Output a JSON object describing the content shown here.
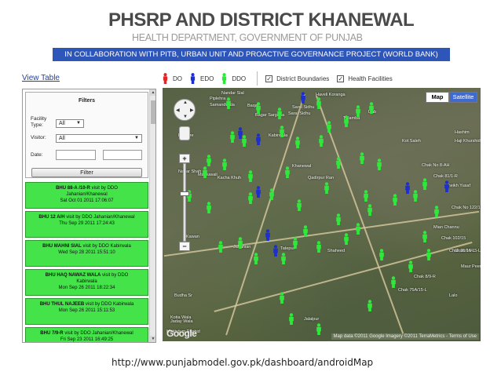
{
  "header": {
    "title": "PHSRP AND DISTRICT KHANEWAL",
    "subtitle": "HEALTH DEPARTMENT, GOVERNMENT OF PUNJAB",
    "banner": "IN COLLABORATION WITH PITB, URBAN UNIT AND PROACTIVE GOVERNANCE PROJECT (WORLD BANK)"
  },
  "links": {
    "view_table": "View Table"
  },
  "legend": {
    "items": [
      {
        "label": "DO",
        "color": "#e52424"
      },
      {
        "label": "EDO",
        "color": "#1d2fd0"
      },
      {
        "label": "DDO",
        "color": "#2ee83a"
      }
    ],
    "checkboxes": [
      {
        "label": "District Boundaries",
        "checked": true
      },
      {
        "label": "Health Facilities",
        "checked": true
      }
    ]
  },
  "filters": {
    "title": "Filters",
    "facility_type_label": "Facility Type:",
    "facility_type_value": "All",
    "visitor_label": "Visitor:",
    "visitor_value": "All",
    "date_label": "Date:",
    "filter_button": "Filter"
  },
  "visits": [
    {
      "facility": "BHU 88-A /10-R",
      "by": "visit by DDO",
      "visitor": "Jahanian/Khanewal",
      "datetime": "Sat Oct 01 2011 17:06:07"
    },
    {
      "facility": "BHU 12 A/H",
      "by": "visit by DDO",
      "visitor": "Jahanian/Khanewal",
      "datetime": "Thu Sep 29 2011 17:24:43"
    },
    {
      "facility": "BHU MAHNI SIAL",
      "by": "visit by DDO",
      "visitor": "Kabirwala",
      "datetime": "Wed Sep 28 2011 15:51:10"
    },
    {
      "facility": "BHU HAQ NAWAZ WALA",
      "by": "visit by DDO",
      "visitor": "Kabirwala",
      "datetime": "Mon Sep 26 2011 18:22:34"
    },
    {
      "facility": "BHU THUL NAJEEB",
      "by": "visit by DDO",
      "visitor": "Kabirwala",
      "datetime": "Mon Sep 26 2011 15:11:53"
    },
    {
      "facility": "BHU 7/9-R",
      "by": "visit by DDO",
      "visitor": "Jahanian/Khanewal",
      "datetime": "Fri Sep 23 2011 16:49:25"
    }
  ],
  "map": {
    "type_map": "Map",
    "type_satellite": "Satellite",
    "google": "Google",
    "attribution": "Map data ©2011 Google Imagery ©2011 TerraMetrics - Terms of Use",
    "places": [
      "Nandar Sial",
      "Piplehra",
      "Samandwala",
      "Haveli Koranga",
      "Baqar",
      "Saral Sidhu",
      "Dab",
      "Tulamba",
      "Kahrore",
      "Bagar Sargana",
      "Nahar Shah",
      "Mamuwali",
      "Kabirwala",
      "Khanewal",
      "Chak No 8-AH",
      "Kacha Khuh",
      "Qadirpur Ran",
      "Kawan",
      "Tatepur",
      "Jahanian",
      "Shaheed",
      "Chak No 122/15",
      "Mian Channu",
      "Budha Sr",
      "Kotia Wala",
      "Jalalpur",
      "Chak 75A/15-L",
      "Chak 8/9-R",
      "Makhdum Rashid",
      "Jaday Wala",
      "Chak 102/15",
      "Chak 94/15-L",
      "Maur Peer",
      "Chak 81/1-R",
      "Sheikh Yusaf",
      "Hashim",
      "Chak 95/15-L",
      "Lalo",
      "Haji Khurshidwala",
      "Kot Saleh",
      "Sarai Sidhu"
    ]
  }
}
